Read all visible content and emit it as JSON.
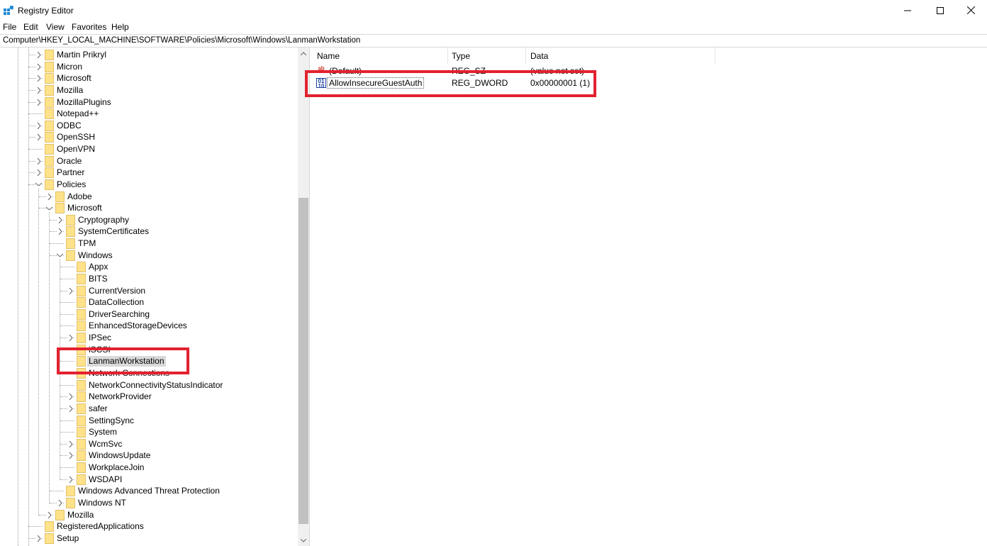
{
  "window": {
    "title": "Registry Editor"
  },
  "menu": {
    "items": [
      "File",
      "Edit",
      "View",
      "Favorites",
      "Help"
    ]
  },
  "address": {
    "path": "Computer\\HKEY_LOCAL_MACHINE\\SOFTWARE\\Policies\\Microsoft\\Windows\\LanmanWorkstation"
  },
  "tree": {
    "nodes": [
      {
        "label": "Martin Prikryl",
        "depth": 0,
        "expander": "right"
      },
      {
        "label": "Micron",
        "depth": 0,
        "expander": "right"
      },
      {
        "label": "Microsoft",
        "depth": 0,
        "expander": "right"
      },
      {
        "label": "Mozilla",
        "depth": 0,
        "expander": "right"
      },
      {
        "label": "MozillaPlugins",
        "depth": 0,
        "expander": "right"
      },
      {
        "label": "Notepad++",
        "depth": 0,
        "expander": "none"
      },
      {
        "label": "ODBC",
        "depth": 0,
        "expander": "right"
      },
      {
        "label": "OpenSSH",
        "depth": 0,
        "expander": "right"
      },
      {
        "label": "OpenVPN",
        "depth": 0,
        "expander": "none"
      },
      {
        "label": "Oracle",
        "depth": 0,
        "expander": "right"
      },
      {
        "label": "Partner",
        "depth": 0,
        "expander": "right"
      },
      {
        "label": "Policies",
        "depth": 0,
        "expander": "down"
      },
      {
        "label": "Adobe",
        "depth": 1,
        "expander": "right"
      },
      {
        "label": "Microsoft",
        "depth": 1,
        "expander": "down"
      },
      {
        "label": "Cryptography",
        "depth": 2,
        "expander": "right"
      },
      {
        "label": "SystemCertificates",
        "depth": 2,
        "expander": "right"
      },
      {
        "label": "TPM",
        "depth": 2,
        "expander": "none"
      },
      {
        "label": "Windows",
        "depth": 2,
        "expander": "down"
      },
      {
        "label": "Appx",
        "depth": 3,
        "expander": "none"
      },
      {
        "label": "BITS",
        "depth": 3,
        "expander": "none"
      },
      {
        "label": "CurrentVersion",
        "depth": 3,
        "expander": "right"
      },
      {
        "label": "DataCollection",
        "depth": 3,
        "expander": "none"
      },
      {
        "label": "DriverSearching",
        "depth": 3,
        "expander": "none"
      },
      {
        "label": "EnhancedStorageDevices",
        "depth": 3,
        "expander": "none"
      },
      {
        "label": "IPSec",
        "depth": 3,
        "expander": "right"
      },
      {
        "label": "iSCSI",
        "depth": 3,
        "expander": "none"
      },
      {
        "label": "LanmanWorkstation",
        "depth": 3,
        "expander": "none",
        "selected": true
      },
      {
        "label": "Network Connections",
        "depth": 3,
        "expander": "none"
      },
      {
        "label": "NetworkConnectivityStatusIndicator",
        "depth": 3,
        "expander": "none"
      },
      {
        "label": "NetworkProvider",
        "depth": 3,
        "expander": "right"
      },
      {
        "label": "safer",
        "depth": 3,
        "expander": "right"
      },
      {
        "label": "SettingSync",
        "depth": 3,
        "expander": "none"
      },
      {
        "label": "System",
        "depth": 3,
        "expander": "none"
      },
      {
        "label": "WcmSvc",
        "depth": 3,
        "expander": "right"
      },
      {
        "label": "WindowsUpdate",
        "depth": 3,
        "expander": "right"
      },
      {
        "label": "WorkplaceJoin",
        "depth": 3,
        "expander": "none"
      },
      {
        "label": "WSDAPI",
        "depth": 3,
        "expander": "right"
      },
      {
        "label": "Windows Advanced Threat Protection",
        "depth": 2,
        "expander": "none"
      },
      {
        "label": "Windows NT",
        "depth": 2,
        "expander": "right"
      },
      {
        "label": "Mozilla",
        "depth": 1,
        "expander": "right"
      },
      {
        "label": "RegisteredApplications",
        "depth": 0,
        "expander": "none"
      },
      {
        "label": "Setup",
        "depth": 0,
        "expander": "right"
      }
    ]
  },
  "values": {
    "columns": [
      "Name",
      "Type",
      "Data"
    ],
    "rows": [
      {
        "name": "(Default)",
        "type": "REG_SZ",
        "data": "(value not set)",
        "icon": "string-value-icon"
      },
      {
        "name": "AllowInsecureGuestAuth",
        "type": "REG_DWORD",
        "data": "0x00000001 (1)",
        "icon": "dword-value-icon",
        "focused": true
      }
    ]
  },
  "colors": {
    "highlight": "#e3212f",
    "folder": "#fde28a",
    "selection": "#d9d9d9"
  }
}
